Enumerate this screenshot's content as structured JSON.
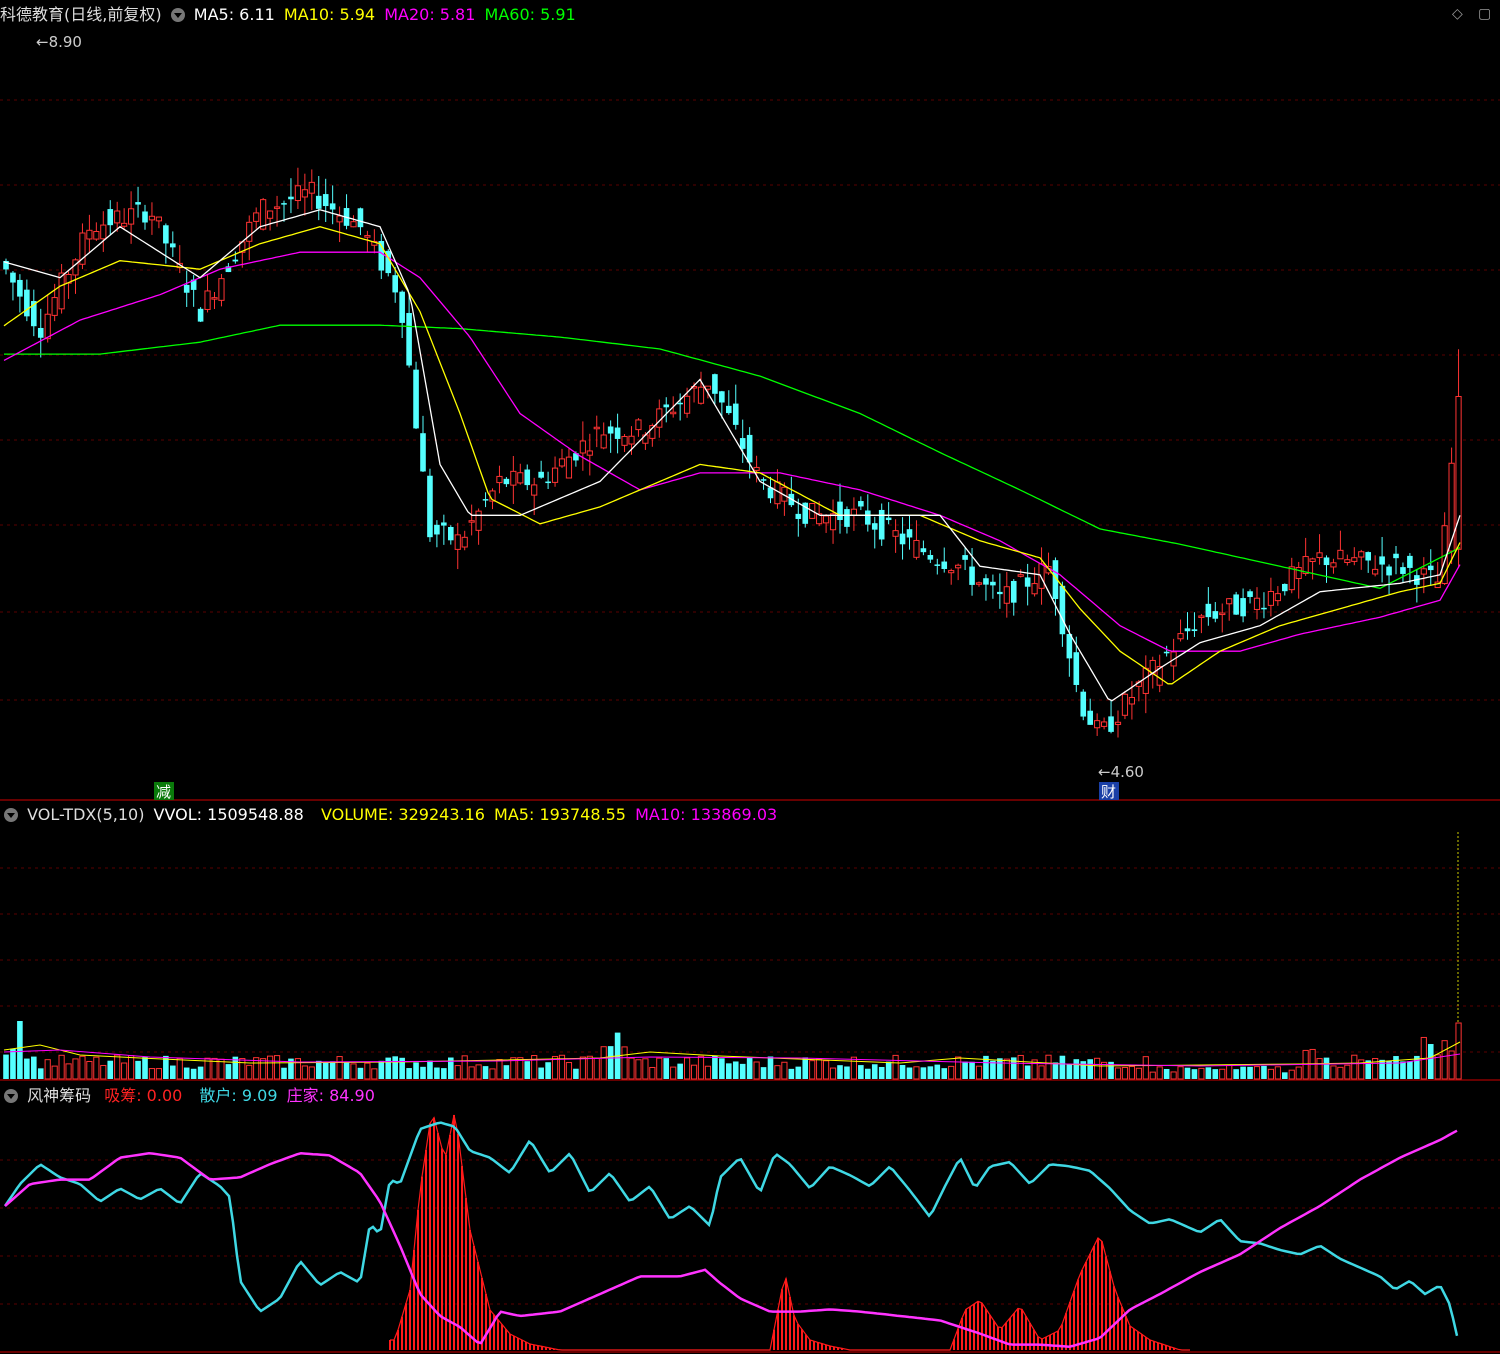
{
  "header": {
    "title": "科德教育(日线,前复权)",
    "ma5": "MA5: 6.11",
    "ma10": "MA10: 5.94",
    "ma20": "MA20: 5.81",
    "ma60": "MA60: 5.91",
    "icons": [
      "diamond-icon",
      "restore-icon"
    ]
  },
  "vol_header": {
    "name": "VOL-TDX(5,10)",
    "vvol": "VVOL: 1509548.88",
    "volume": "VOLUME: 329243.16",
    "ma5": "MA5: 193748.55",
    "ma10": "MA10: 133869.03"
  },
  "ind_header": {
    "name": "风神筹码",
    "xichou": "吸筹: 0.00",
    "sanhu": "散户: 9.09",
    "zhuangjia": "庄家: 84.90"
  },
  "markers": {
    "high_label": "8.90",
    "low_label": "4.60",
    "reduce_tag": "减",
    "fin_tag": "财"
  },
  "colors": {
    "up": "#ff3333",
    "down": "#54ffff",
    "ma5": "#ffffff",
    "ma10": "#ffff00",
    "ma20": "#ff00ff",
    "ma60": "#00ff00",
    "grid": "#5a0000",
    "sanhu": "#3fd8e4",
    "zhuangjia": "#ff33ff",
    "xichou": "#ff1a1a"
  },
  "chart_data": [
    {
      "type": "candlestick",
      "price_range": [
        4.6,
        8.9
      ],
      "grid": true,
      "series": [
        "MA5",
        "MA10",
        "MA20",
        "MA60"
      ],
      "keypoints": {
        "close": [
          [
            0,
            7.6
          ],
          [
            40,
            7.2
          ],
          [
            90,
            7.8
          ],
          [
            150,
            7.9
          ],
          [
            200,
            7.3
          ],
          [
            260,
            7.9
          ],
          [
            310,
            8.0
          ],
          [
            360,
            7.8
          ],
          [
            400,
            7.4
          ],
          [
            430,
            6.0
          ],
          [
            460,
            5.95
          ],
          [
            500,
            6.3
          ],
          [
            540,
            6.3
          ],
          [
            600,
            6.6
          ],
          [
            640,
            6.6
          ],
          [
            710,
            6.9
          ],
          [
            760,
            6.3
          ],
          [
            810,
            6.1
          ],
          [
            860,
            6.1
          ],
          [
            920,
            5.9
          ],
          [
            960,
            5.8
          ],
          [
            1000,
            5.6
          ],
          [
            1050,
            5.8
          ],
          [
            1080,
            5.0
          ],
          [
            1100,
            4.8
          ],
          [
            1140,
            5.1
          ],
          [
            1200,
            5.5
          ],
          [
            1260,
            5.6
          ],
          [
            1320,
            5.85
          ],
          [
            1400,
            5.8
          ],
          [
            1440,
            5.7
          ],
          [
            1460,
            6.9
          ]
        ],
        "ma5": [
          [
            0,
            7.6
          ],
          [
            60,
            7.5
          ],
          [
            120,
            7.8
          ],
          [
            200,
            7.5
          ],
          [
            260,
            7.8
          ],
          [
            320,
            7.9
          ],
          [
            380,
            7.8
          ],
          [
            410,
            7.4
          ],
          [
            440,
            6.4
          ],
          [
            470,
            6.1
          ],
          [
            520,
            6.1
          ],
          [
            600,
            6.3
          ],
          [
            700,
            6.9
          ],
          [
            760,
            6.3
          ],
          [
            820,
            6.1
          ],
          [
            880,
            6.1
          ],
          [
            940,
            6.1
          ],
          [
            980,
            5.8
          ],
          [
            1040,
            5.75
          ],
          [
            1070,
            5.4
          ],
          [
            1110,
            5.0
          ],
          [
            1160,
            5.2
          ],
          [
            1200,
            5.35
          ],
          [
            1260,
            5.45
          ],
          [
            1320,
            5.65
          ],
          [
            1400,
            5.7
          ],
          [
            1440,
            5.75
          ],
          [
            1460,
            6.1
          ]
        ],
        "ma10": [
          [
            0,
            7.2
          ],
          [
            60,
            7.45
          ],
          [
            120,
            7.6
          ],
          [
            200,
            7.55
          ],
          [
            260,
            7.7
          ],
          [
            320,
            7.8
          ],
          [
            380,
            7.7
          ],
          [
            420,
            7.3
          ],
          [
            460,
            6.7
          ],
          [
            490,
            6.2
          ],
          [
            540,
            6.05
          ],
          [
            600,
            6.15
          ],
          [
            700,
            6.4
          ],
          [
            760,
            6.35
          ],
          [
            840,
            6.1
          ],
          [
            920,
            6.1
          ],
          [
            980,
            5.95
          ],
          [
            1040,
            5.85
          ],
          [
            1080,
            5.55
          ],
          [
            1120,
            5.3
          ],
          [
            1170,
            5.1
          ],
          [
            1220,
            5.3
          ],
          [
            1280,
            5.45
          ],
          [
            1340,
            5.55
          ],
          [
            1400,
            5.65
          ],
          [
            1440,
            5.7
          ],
          [
            1460,
            5.94
          ]
        ],
        "ma20": [
          [
            0,
            7.0
          ],
          [
            80,
            7.25
          ],
          [
            160,
            7.4
          ],
          [
            220,
            7.55
          ],
          [
            300,
            7.65
          ],
          [
            380,
            7.65
          ],
          [
            420,
            7.5
          ],
          [
            470,
            7.15
          ],
          [
            520,
            6.7
          ],
          [
            580,
            6.45
          ],
          [
            640,
            6.25
          ],
          [
            700,
            6.35
          ],
          [
            780,
            6.35
          ],
          [
            860,
            6.25
          ],
          [
            940,
            6.1
          ],
          [
            1000,
            5.95
          ],
          [
            1060,
            5.75
          ],
          [
            1120,
            5.45
          ],
          [
            1170,
            5.3
          ],
          [
            1240,
            5.3
          ],
          [
            1300,
            5.4
          ],
          [
            1380,
            5.5
          ],
          [
            1440,
            5.6
          ],
          [
            1460,
            5.81
          ]
        ],
        "ma60": [
          [
            0,
            7.05
          ],
          [
            100,
            7.05
          ],
          [
            200,
            7.12
          ],
          [
            280,
            7.22
          ],
          [
            380,
            7.22
          ],
          [
            460,
            7.2
          ],
          [
            560,
            7.15
          ],
          [
            660,
            7.08
          ],
          [
            760,
            6.92
          ],
          [
            860,
            6.7
          ],
          [
            940,
            6.47
          ],
          [
            1020,
            6.25
          ],
          [
            1100,
            6.02
          ],
          [
            1180,
            5.93
          ],
          [
            1280,
            5.8
          ],
          [
            1380,
            5.67
          ],
          [
            1460,
            5.91
          ]
        ]
      }
    },
    {
      "type": "bar",
      "name": "VOL-TDX(5,10)",
      "series": [
        "VOLUME",
        "MA5",
        "MA10"
      ]
    },
    {
      "type": "line",
      "name": "风神筹码",
      "series": [
        "吸筹",
        "散户",
        "庄家"
      ],
      "keypoints": {
        "sanhu": [
          [
            5,
            60
          ],
          [
            20,
            70
          ],
          [
            40,
            79
          ],
          [
            60,
            73
          ],
          [
            80,
            70
          ],
          [
            100,
            62
          ],
          [
            120,
            68
          ],
          [
            140,
            63
          ],
          [
            160,
            68
          ],
          [
            180,
            61
          ],
          [
            200,
            75
          ],
          [
            220,
            69
          ],
          [
            230,
            64
          ],
          [
            240,
            26
          ],
          [
            260,
            12
          ],
          [
            280,
            18
          ],
          [
            300,
            35
          ],
          [
            320,
            24
          ],
          [
            340,
            30
          ],
          [
            360,
            25
          ],
          [
            370,
            52
          ],
          [
            380,
            47
          ],
          [
            390,
            72
          ],
          [
            400,
            70
          ],
          [
            420,
            95
          ],
          [
            440,
            98
          ],
          [
            455,
            96
          ],
          [
            470,
            85
          ],
          [
            490,
            82
          ],
          [
            510,
            75
          ],
          [
            530,
            90
          ],
          [
            550,
            75
          ],
          [
            570,
            84
          ],
          [
            590,
            66
          ],
          [
            610,
            75
          ],
          [
            630,
            62
          ],
          [
            650,
            69
          ],
          [
            670,
            54
          ],
          [
            690,
            60
          ],
          [
            710,
            51
          ],
          [
            720,
            73
          ],
          [
            740,
            82
          ],
          [
            760,
            66
          ],
          [
            775,
            84
          ],
          [
            790,
            79
          ],
          [
            810,
            68
          ],
          [
            830,
            78
          ],
          [
            850,
            74
          ],
          [
            870,
            69
          ],
          [
            890,
            78
          ],
          [
            910,
            67
          ],
          [
            930,
            55
          ],
          [
            945,
            69
          ],
          [
            960,
            82
          ],
          [
            975,
            68
          ],
          [
            990,
            78
          ],
          [
            1010,
            80
          ],
          [
            1030,
            70
          ],
          [
            1050,
            79
          ],
          [
            1070,
            78
          ],
          [
            1090,
            76
          ],
          [
            1110,
            68
          ],
          [
            1130,
            58
          ],
          [
            1150,
            52
          ],
          [
            1170,
            54
          ],
          [
            1200,
            48
          ],
          [
            1220,
            54
          ],
          [
            1240,
            44
          ],
          [
            1260,
            43
          ],
          [
            1280,
            40
          ],
          [
            1300,
            38
          ],
          [
            1320,
            42
          ],
          [
            1340,
            36
          ],
          [
            1360,
            32
          ],
          [
            1380,
            28
          ],
          [
            1395,
            22
          ],
          [
            1410,
            26
          ],
          [
            1425,
            20
          ],
          [
            1440,
            24
          ],
          [
            1450,
            15
          ],
          [
            1460,
            -5
          ]
        ],
        "zhuangjia": [
          [
            5,
            60
          ],
          [
            30,
            70
          ],
          [
            60,
            72
          ],
          [
            90,
            72
          ],
          [
            120,
            82
          ],
          [
            150,
            84
          ],
          [
            180,
            82
          ],
          [
            210,
            72
          ],
          [
            240,
            73
          ],
          [
            270,
            79
          ],
          [
            300,
            84
          ],
          [
            330,
            83
          ],
          [
            360,
            75
          ],
          [
            380,
            62
          ],
          [
            400,
            42
          ],
          [
            420,
            20
          ],
          [
            440,
            10
          ],
          [
            460,
            5
          ],
          [
            480,
            -3
          ],
          [
            500,
            12
          ],
          [
            520,
            10
          ],
          [
            560,
            12
          ],
          [
            600,
            20
          ],
          [
            640,
            28
          ],
          [
            680,
            28
          ],
          [
            705,
            31
          ],
          [
            720,
            25
          ],
          [
            740,
            18
          ],
          [
            770,
            12
          ],
          [
            800,
            12
          ],
          [
            830,
            13
          ],
          [
            860,
            12
          ],
          [
            900,
            10
          ],
          [
            940,
            8
          ],
          [
            980,
            2
          ],
          [
            1010,
            -3
          ],
          [
            1040,
            -3
          ],
          [
            1070,
            -4
          ],
          [
            1100,
            0
          ],
          [
            1130,
            13
          ],
          [
            1160,
            20
          ],
          [
            1200,
            30
          ],
          [
            1240,
            38
          ],
          [
            1280,
            50
          ],
          [
            1320,
            60
          ],
          [
            1360,
            72
          ],
          [
            1400,
            82
          ],
          [
            1440,
            90
          ],
          [
            1460,
            95
          ]
        ],
        "xichou": [
          [
            395,
            5
          ],
          [
            410,
            30
          ],
          [
            420,
            80
          ],
          [
            432,
            120
          ],
          [
            445,
            95
          ],
          [
            455,
            120
          ],
          [
            470,
            60
          ],
          [
            490,
            20
          ],
          [
            510,
            8
          ],
          [
            530,
            3
          ],
          [
            560,
            0
          ],
          [
            770,
            0
          ],
          [
            785,
            38
          ],
          [
            795,
            15
          ],
          [
            810,
            5
          ],
          [
            830,
            2
          ],
          [
            850,
            0
          ],
          [
            950,
            0
          ],
          [
            965,
            20
          ],
          [
            980,
            25
          ],
          [
            1000,
            10
          ],
          [
            1020,
            22
          ],
          [
            1040,
            5
          ],
          [
            1060,
            10
          ],
          [
            1080,
            38
          ],
          [
            1100,
            58
          ],
          [
            1115,
            30
          ],
          [
            1130,
            12
          ],
          [
            1150,
            5
          ],
          [
            1180,
            0
          ]
        ]
      }
    }
  ]
}
